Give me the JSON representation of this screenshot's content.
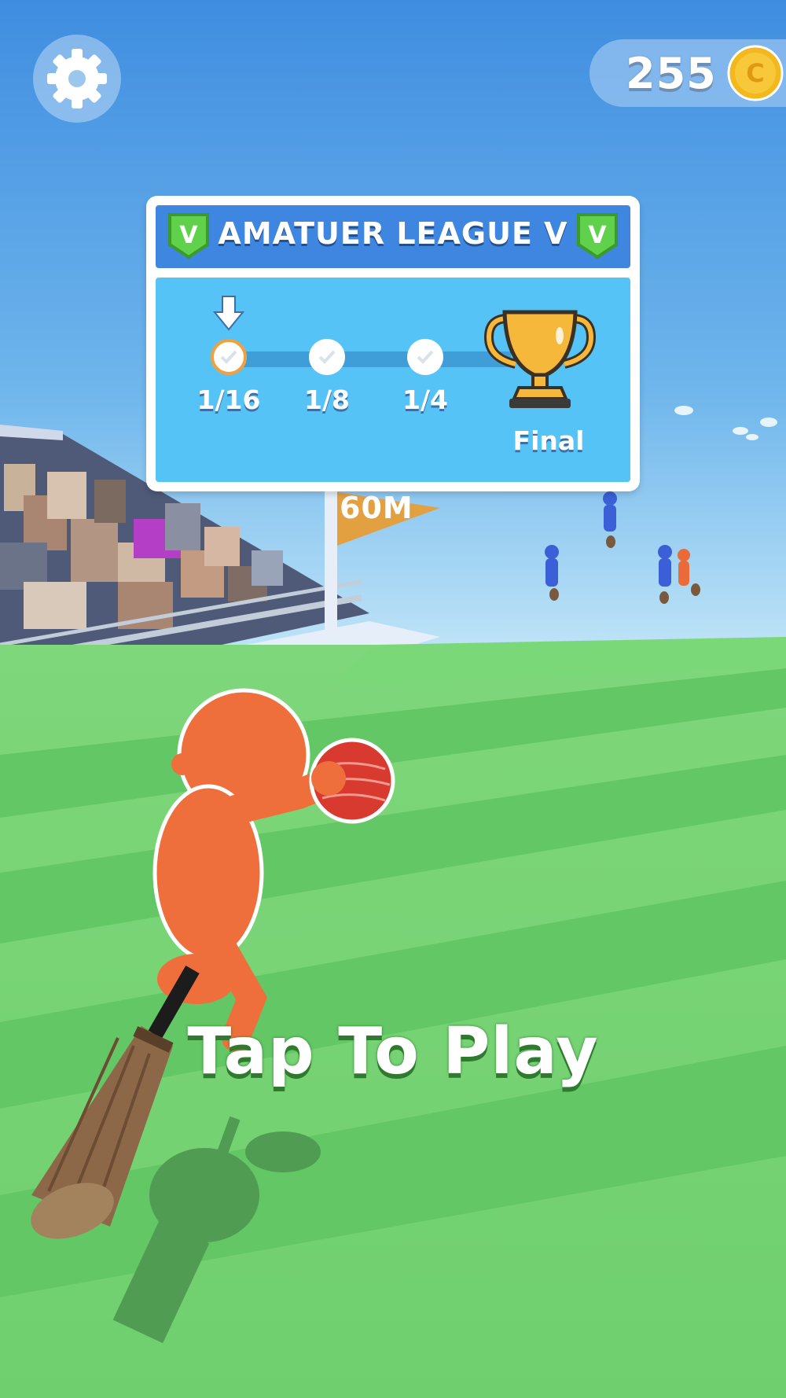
{
  "hud": {
    "coin_count": "255",
    "coin_symbol": "C"
  },
  "league_board": {
    "title": "AMATUER LEAGUE V",
    "badge_letter": "V",
    "stages": [
      {
        "label": "1/16",
        "state": "current"
      },
      {
        "label": "1/8",
        "state": "pending"
      },
      {
        "label": "1/4",
        "state": "pending"
      }
    ],
    "final_label": "Final"
  },
  "field": {
    "distance_marker": "60M"
  },
  "prompt": {
    "tap_to_play": "Tap To Play"
  },
  "colors": {
    "sky_top": "#3f8ee0",
    "grass": "#5ecb62",
    "board_header": "#3f86e0",
    "board_body": "#56c3f6",
    "player": "#ef6f3c",
    "ball": "#d83a30",
    "trophy": "#f5b83a"
  }
}
